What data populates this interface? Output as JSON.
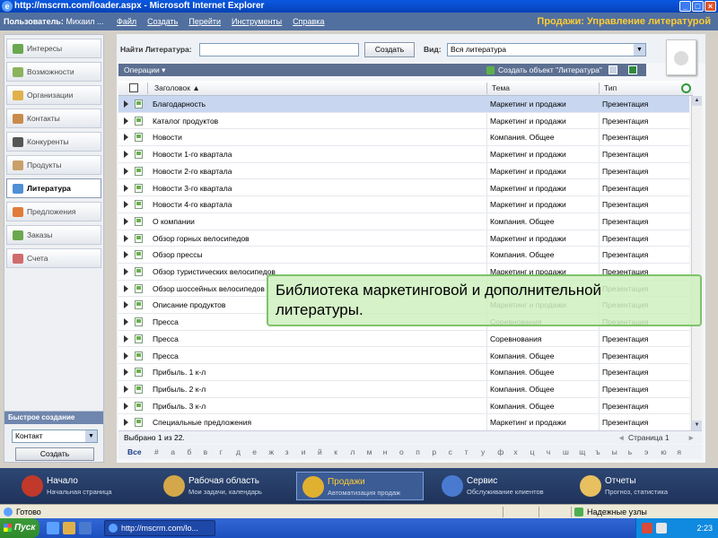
{
  "window": {
    "title": "http://mscrm.com/loader.aspx - Microsoft Internet Explorer"
  },
  "menubar": {
    "user_label": "Пользователь:",
    "user_name": "Михаил ...",
    "items": [
      "Файл",
      "Создать",
      "Перейти",
      "Инструменты",
      "Справка"
    ],
    "app_title": "Продажи: Управление литературой"
  },
  "leftnav": {
    "items": [
      {
        "label": "Интересы",
        "color": "#6aa84f"
      },
      {
        "label": "Возможности",
        "color": "#8bb35a"
      },
      {
        "label": "Организации",
        "color": "#e0b14a"
      },
      {
        "label": "Контакты",
        "color": "#c98b4a"
      },
      {
        "label": "Конкуренты",
        "color": "#555555"
      },
      {
        "label": "Продукты",
        "color": "#c9a06a"
      },
      {
        "label": "Литература",
        "color": "#4f8fd6"
      },
      {
        "label": "Предложения",
        "color": "#e07b39"
      },
      {
        "label": "Заказы",
        "color": "#6aa84f"
      },
      {
        "label": "Счета",
        "color": "#d06b6b"
      }
    ],
    "active_index": 6
  },
  "quick_create": {
    "title": "Быстрое создание",
    "selected": "Контакт",
    "button": "Создать"
  },
  "main": {
    "find_label": "Найти Литература:",
    "find_value": "",
    "create_button": "Создать",
    "view_label": "Вид:",
    "view_selected": "Вся литература",
    "operations": "Операции ▾",
    "new_object": "Создать объект \"Литература\"",
    "columns": {
      "title": "Заголовок ▲",
      "subject": "Тема",
      "type": "Тип"
    },
    "rows": [
      {
        "title": "Благодарность",
        "subject": "Маркетинг и продажи",
        "type": "Презентация"
      },
      {
        "title": "Каталог продуктов",
        "subject": "Маркетинг и продажи",
        "type": "Презентация"
      },
      {
        "title": "Новости",
        "subject": "Компания. Общее",
        "type": "Презентация"
      },
      {
        "title": "Новости 1-го квартала",
        "subject": "Маркетинг и продажи",
        "type": "Презентация"
      },
      {
        "title": "Новости 2-го квартала",
        "subject": "Маркетинг и продажи",
        "type": "Презентация"
      },
      {
        "title": "Новости 3-го квартала",
        "subject": "Маркетинг и продажи",
        "type": "Презентация"
      },
      {
        "title": "Новости 4-го квартала",
        "subject": "Маркетинг и продажи",
        "type": "Презентация"
      },
      {
        "title": "О компании",
        "subject": "Компания. Общее",
        "type": "Презентация"
      },
      {
        "title": "Обзор горных велосипедов",
        "subject": "Маркетинг и продажи",
        "type": "Презентация"
      },
      {
        "title": "Обзор прессы",
        "subject": "Компания. Общее",
        "type": "Презентация"
      },
      {
        "title": "Обзор туристических велосипедов",
        "subject": "Маркетинг и продажи",
        "type": "Презентация"
      },
      {
        "title": "Обзор шоссейных велосипедов",
        "subject": "Маркетинг и продажи",
        "type": "Презентация"
      },
      {
        "title": "Описание продуктов",
        "subject": "Маркетинг и продажи",
        "type": "Презентация"
      },
      {
        "title": "Пресса",
        "subject": "Соревнования",
        "type": "Презентация"
      },
      {
        "title": "Пресса",
        "subject": "Соревнования",
        "type": "Презентация"
      },
      {
        "title": "Пресса",
        "subject": "Компания. Общее",
        "type": "Презентация"
      },
      {
        "title": "Прибыль. 1 к-л",
        "subject": "Компания. Общее",
        "type": "Презентация"
      },
      {
        "title": "Прибыль. 2 к-л",
        "subject": "Компания. Общее",
        "type": "Презентация"
      },
      {
        "title": "Прибыль. 3 к-л",
        "subject": "Компания. Общее",
        "type": "Презентация"
      },
      {
        "title": "Специальные предложения",
        "subject": "Маркетинг и продажи",
        "type": "Презентация"
      }
    ],
    "selected_count": "Выбрано 1 из 22.",
    "page": "Страница 1",
    "alphabet": [
      "Все",
      "#",
      "а",
      "б",
      "в",
      "г",
      "д",
      "е",
      "ж",
      "з",
      "и",
      "й",
      "к",
      "л",
      "м",
      "н",
      "о",
      "п",
      "р",
      "с",
      "т",
      "у",
      "ф",
      "х",
      "ц",
      "ч",
      "ш",
      "щ",
      "ъ",
      "ы",
      "ь",
      "э",
      "ю",
      "я"
    ]
  },
  "overlay": {
    "text": "Библиотека маркетинговой и дополнительной литературы."
  },
  "bottomnav": {
    "items": [
      {
        "title": "Начало",
        "subtitle": "Начальная страница",
        "color": "#c0392b"
      },
      {
        "title": "Рабочая область",
        "subtitle": "Мои задачи, календарь",
        "color": "#d4a84a"
      },
      {
        "title": "Продажи",
        "subtitle": "Автоматизация продаж",
        "color": "#e0b030"
      },
      {
        "title": "Сервис",
        "subtitle": "Обслуживание клиентов",
        "color": "#4a7ad0"
      },
      {
        "title": "Отчеты",
        "subtitle": "Прогноз, статистика",
        "color": "#e8c060"
      }
    ],
    "active_index": 2
  },
  "iestatus": {
    "ready": "Готово",
    "zone": "Надежные узлы"
  },
  "taskbar": {
    "start": "Пуск",
    "task": "http://mscrm.com/lo...",
    "lang": "RU",
    "clock": "2:23"
  }
}
